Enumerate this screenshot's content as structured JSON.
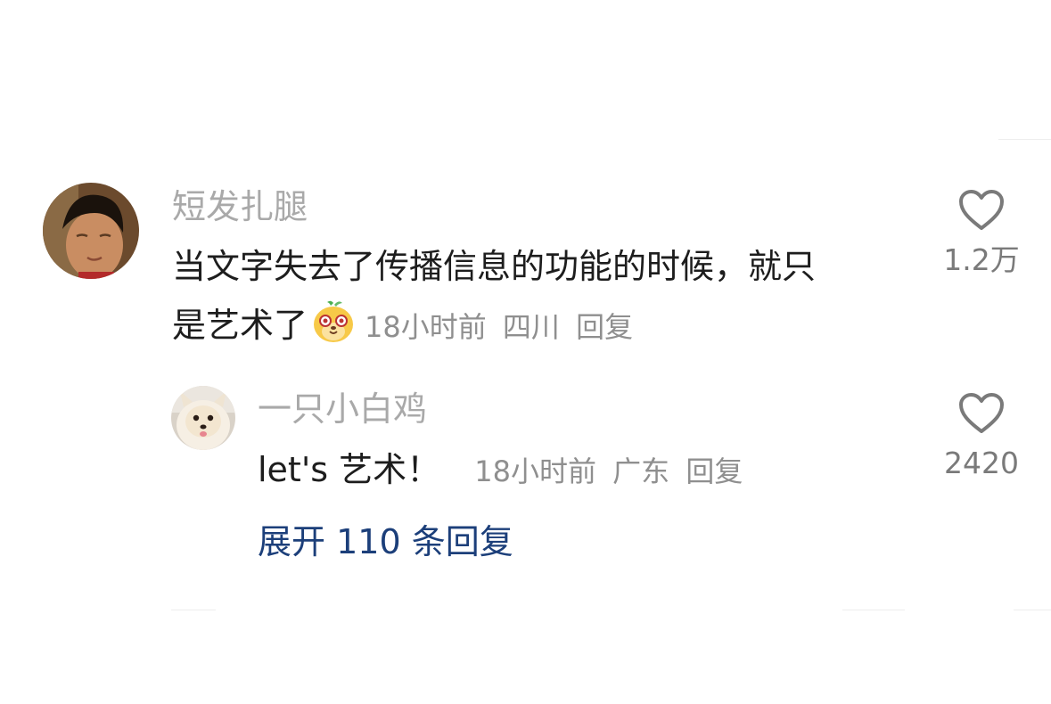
{
  "comments": [
    {
      "username": "短发扎腿",
      "text_line1": "当文字失去了传播信息的功能的时候，就只",
      "text_line2": "是艺术了",
      "emoji_icon": "blushing-face-emoji",
      "time": "18小时前",
      "location": "四川",
      "reply_label": "回复",
      "likes": "1.2万"
    },
    {
      "username": "一只小白鸡",
      "text": "let's 艺术！",
      "time": "18小时前",
      "location": "广东",
      "reply_label": "回复",
      "likes": "2420"
    }
  ],
  "expand_replies": {
    "prefix": "展开",
    "count": "110",
    "suffix": "条回复"
  },
  "colors": {
    "username": "#a9a9a9",
    "meta": "#8f8f8f",
    "expand_link": "#1c3f7a",
    "heart_outline": "#7a7a7a"
  }
}
